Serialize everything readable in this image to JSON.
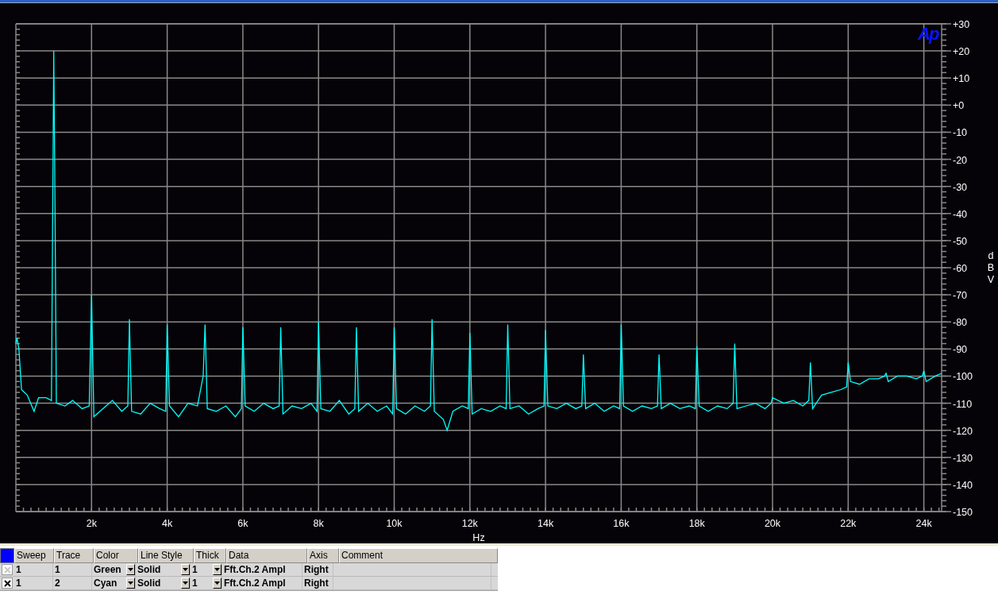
{
  "logo": "Ap",
  "chart": {
    "chart_data": {
      "type": "line",
      "grid": true,
      "xlabel": "Hz",
      "ylabel": "dBV",
      "xlim": [
        0,
        24470
      ],
      "ylim": [
        -150,
        30
      ],
      "xticks": [
        {
          "value": 2000,
          "label": "2k"
        },
        {
          "value": 4000,
          "label": "4k"
        },
        {
          "value": 6000,
          "label": "6k"
        },
        {
          "value": 8000,
          "label": "8k"
        },
        {
          "value": 10000,
          "label": "10k"
        },
        {
          "value": 12000,
          "label": "12k"
        },
        {
          "value": 14000,
          "label": "14k"
        },
        {
          "value": 16000,
          "label": "16k"
        },
        {
          "value": 18000,
          "label": "18k"
        },
        {
          "value": 20000,
          "label": "20k"
        },
        {
          "value": 22000,
          "label": "22k"
        },
        {
          "value": 24000,
          "label": "24k"
        }
      ],
      "yticks": [
        {
          "value": 30,
          "label": "+30"
        },
        {
          "value": 20,
          "label": "+20"
        },
        {
          "value": 10,
          "label": "+10"
        },
        {
          "value": 0,
          "label": "+0"
        },
        -10,
        -20,
        -30,
        -40,
        -50,
        -60,
        -70,
        -80,
        -90,
        -100,
        -110,
        -120,
        -130,
        -140,
        -150
      ],
      "x": [
        0,
        30,
        80,
        150,
        300,
        480,
        600,
        800,
        940,
        1000,
        1030,
        1070,
        1300,
        1500,
        1750,
        1940,
        2000,
        2060,
        2300,
        2550,
        2800,
        2960,
        3000,
        3060,
        3300,
        3550,
        3800,
        3960,
        4000,
        4060,
        4300,
        4550,
        4800,
        4950,
        5000,
        5060,
        5300,
        5550,
        5800,
        5960,
        6000,
        6060,
        6300,
        6550,
        6800,
        6960,
        7000,
        7060,
        7300,
        7550,
        7800,
        7960,
        8000,
        8060,
        8300,
        8550,
        8800,
        8960,
        9000,
        9060,
        9300,
        9550,
        9800,
        9960,
        10000,
        10060,
        10300,
        10550,
        10800,
        10960,
        11000,
        11060,
        11300,
        11400,
        11550,
        11800,
        11960,
        12000,
        12060,
        12300,
        12550,
        12800,
        12960,
        13000,
        13060,
        13300,
        13550,
        13800,
        13960,
        14000,
        14060,
        14300,
        14550,
        14800,
        14960,
        15000,
        15060,
        15300,
        15550,
        15800,
        15960,
        16000,
        16060,
        16300,
        16550,
        16800,
        16960,
        17000,
        17060,
        17300,
        17550,
        17800,
        17960,
        18000,
        18060,
        18300,
        18550,
        18800,
        18960,
        19000,
        19060,
        19300,
        19550,
        19800,
        19960,
        20000,
        20300,
        20550,
        20800,
        20960,
        21000,
        21060,
        21300,
        21550,
        21800,
        21960,
        22000,
        22060,
        22300,
        22550,
        22800,
        22960,
        23000,
        23060,
        23300,
        23550,
        23800,
        23960,
        24000,
        24060,
        24300,
        24470
      ],
      "series": [
        {
          "color": "#00ffff",
          "values": [
            -88,
            -86,
            -90,
            -105,
            -107,
            -113,
            -108,
            -108,
            -109,
            20,
            -30,
            -110,
            -111,
            -109,
            -112,
            -111,
            -70,
            -115,
            -112,
            -109,
            -113,
            -111,
            -79,
            -113,
            -114,
            -110,
            -112,
            -113,
            -81,
            -111,
            -115,
            -110,
            -111,
            -100,
            -81,
            -112,
            -113,
            -111,
            -115,
            -112,
            -82,
            -111,
            -113,
            -110,
            -112,
            -111,
            -82,
            -114,
            -111,
            -112,
            -110,
            -113,
            -80,
            -112,
            -113,
            -109,
            -114,
            -112,
            -82,
            -113,
            -110,
            -113,
            -111,
            -114,
            -82,
            -112,
            -114,
            -111,
            -113,
            -111,
            -79,
            -113,
            -116,
            -120,
            -113,
            -111,
            -112,
            -84,
            -114,
            -112,
            -113,
            -111,
            -112,
            -81,
            -112,
            -111,
            -114,
            -112,
            -111,
            -83,
            -111,
            -112,
            -110,
            -112,
            -111,
            -92,
            -112,
            -110,
            -113,
            -111,
            -112,
            -81,
            -111,
            -113,
            -111,
            -112,
            -111,
            -92,
            -112,
            -110,
            -112,
            -111,
            -112,
            -89,
            -111,
            -113,
            -111,
            -112,
            -110,
            -88,
            -112,
            -111,
            -110,
            -112,
            -110,
            -108,
            -110,
            -109,
            -111,
            -109,
            -95,
            -112,
            -107,
            -106,
            -105,
            -104,
            -95,
            -102,
            -103,
            -101,
            -101,
            -100,
            -99,
            -102,
            -100,
            -100,
            -101,
            -100,
            -98,
            -102,
            -100,
            -99
          ]
        }
      ]
    }
  },
  "legend": {
    "columns": [
      "Sweep",
      "Trace",
      "Color",
      "Line Style",
      "Thick",
      "Data",
      "Axis",
      "Comment"
    ],
    "rows": [
      {
        "checked": false,
        "sweep": "1",
        "trace": "1",
        "color_name": "Green",
        "line_style": "Solid",
        "thick": "1",
        "data": "Fft.Ch.2 Ampl",
        "axis": "Right"
      },
      {
        "checked": true,
        "sweep": "1",
        "trace": "2",
        "color_name": "Cyan",
        "line_style": "Solid",
        "thick": "1",
        "data": "Fft.Ch.2 Ampl",
        "axis": "Right"
      }
    ]
  }
}
